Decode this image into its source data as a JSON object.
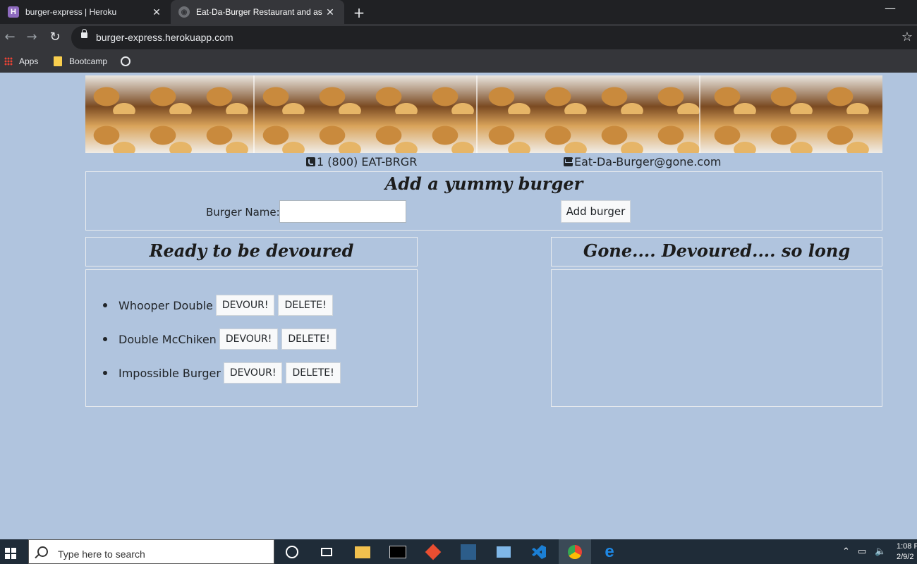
{
  "browser": {
    "tabs": [
      {
        "title": "burger-express | Heroku",
        "favicon": "H"
      },
      {
        "title": "Eat-Da-Burger Restaurant and as"
      }
    ],
    "url": "burger-express.herokuapp.com",
    "bookmarks": [
      "Apps",
      "Bootcamp"
    ]
  },
  "contact": {
    "phone": "1 (800) EAT-BRGR",
    "email": "Eat-Da-Burger@gone.com"
  },
  "form": {
    "title": "Add a yummy burger",
    "label": "Burger Name:",
    "input_value": "",
    "submit_label": "Add burger"
  },
  "ready": {
    "title": "Ready to be devoured",
    "burgers": [
      {
        "name": "Whooper Double",
        "devour": "DEVOUR!",
        "delete": "DELETE!"
      },
      {
        "name": "Double McChiken",
        "devour": "DEVOUR!",
        "delete": "DELETE!"
      },
      {
        "name": "Impossible Burger",
        "devour": "DEVOUR!",
        "delete": "DELETE!"
      }
    ]
  },
  "devoured": {
    "title": "Gone.... Devoured.... so long",
    "burgers": []
  },
  "taskbar": {
    "search_placeholder": "Type here to search",
    "time": "1:08 P",
    "date": "2/9/2"
  },
  "colors": {
    "page_bg": "#b0c4de",
    "chrome_dark": "#202124",
    "taskbar_bg": "#1f2c38"
  }
}
